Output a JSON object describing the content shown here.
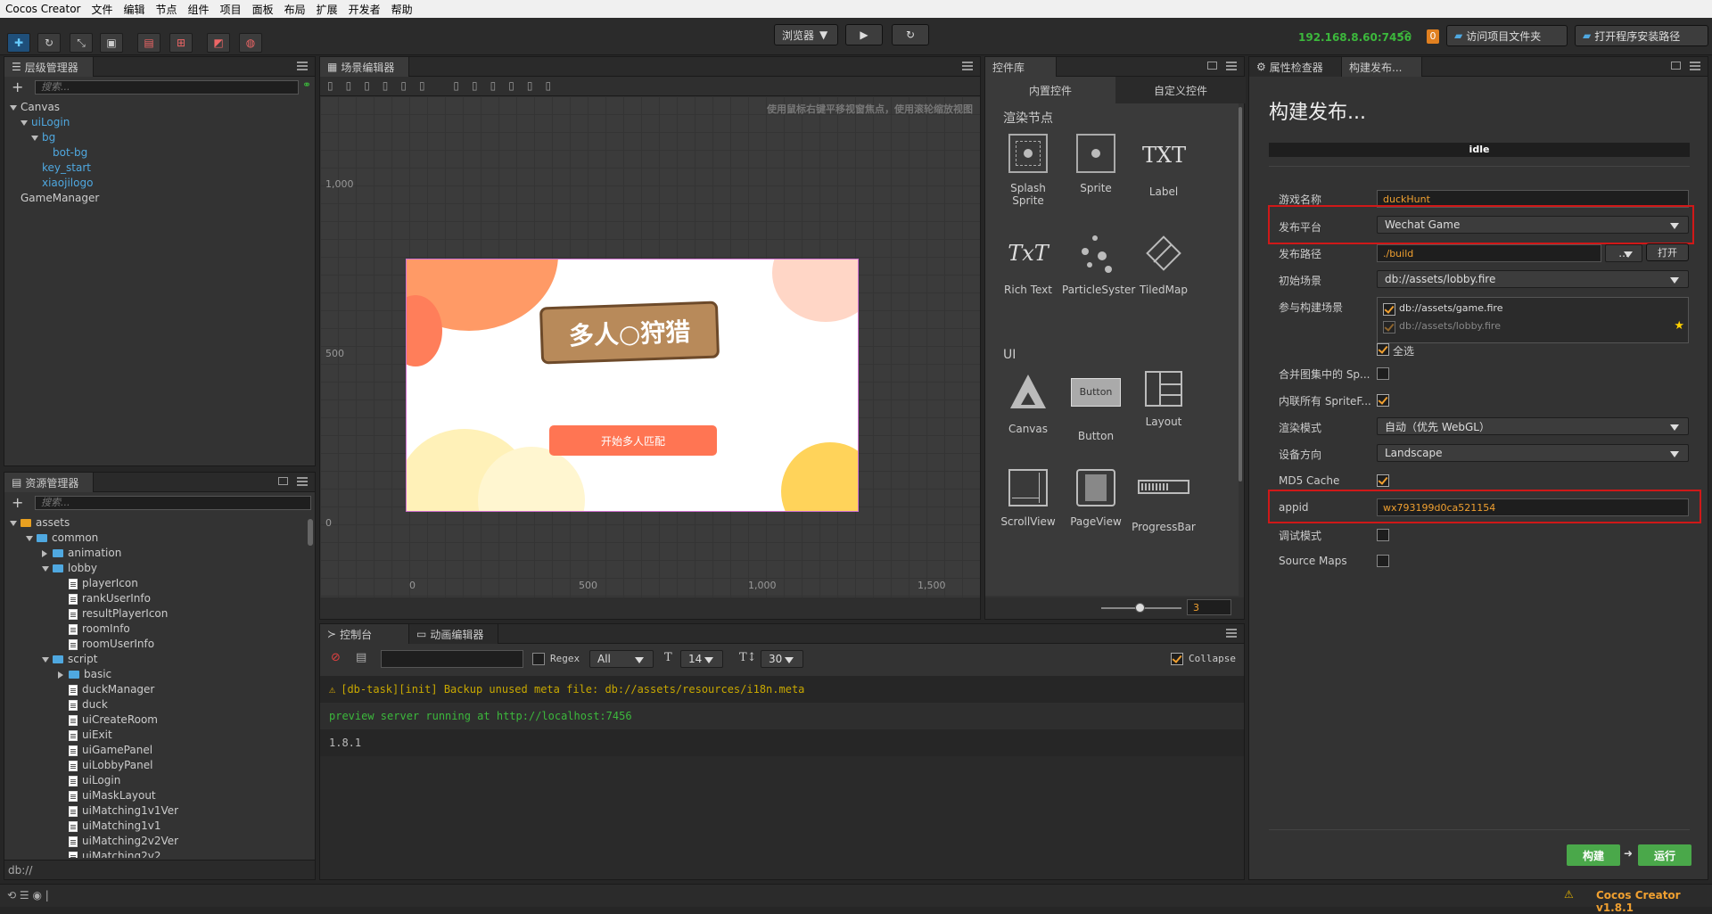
{
  "menubar": {
    "app": "Cocos Creator",
    "items": [
      "文件",
      "编辑",
      "节点",
      "组件",
      "项目",
      "面板",
      "布局",
      "扩展",
      "开发者",
      "帮助"
    ]
  },
  "toolbar": {
    "browser_label": "浏览器",
    "ip": "192.168.8.60:7456",
    "badge": "0",
    "open_project_folder": "访问项目文件夹",
    "open_install_path": "打开程序安装路径"
  },
  "hierarchy": {
    "title": "层级管理器",
    "search_placeholder": "搜索...",
    "nodes": [
      {
        "label": "Canvas",
        "depth": 0,
        "expanded": true
      },
      {
        "label": "uiLogin",
        "depth": 1,
        "expanded": true
      },
      {
        "label": "bg",
        "depth": 2,
        "expanded": true
      },
      {
        "label": "bot-bg",
        "depth": 3
      },
      {
        "label": "key_start",
        "depth": 2
      },
      {
        "label": "xiaojilogo",
        "depth": 2
      },
      {
        "label": "GameManager",
        "depth": 0
      }
    ]
  },
  "assets": {
    "title": "资源管理器",
    "search_placeholder": "搜索...",
    "footer_path": "db://",
    "items": [
      {
        "label": "assets",
        "depth": 0,
        "type": "root"
      },
      {
        "label": "common",
        "depth": 1,
        "type": "folder",
        "expanded": true
      },
      {
        "label": "animation",
        "depth": 2,
        "type": "folder",
        "expanded": false
      },
      {
        "label": "lobby",
        "depth": 2,
        "type": "folder",
        "expanded": true
      },
      {
        "label": "playerIcon",
        "depth": 3,
        "type": "file"
      },
      {
        "label": "rankUserInfo",
        "depth": 3,
        "type": "file"
      },
      {
        "label": "resultPlayerIcon",
        "depth": 3,
        "type": "file"
      },
      {
        "label": "roomInfo",
        "depth": 3,
        "type": "file"
      },
      {
        "label": "roomUserInfo",
        "depth": 3,
        "type": "file"
      },
      {
        "label": "script",
        "depth": 2,
        "type": "folder",
        "expanded": true
      },
      {
        "label": "basic",
        "depth": 3,
        "type": "folder",
        "expanded": false
      },
      {
        "label": "duckManager",
        "depth": 3,
        "type": "file"
      },
      {
        "label": "duck",
        "depth": 3,
        "type": "file"
      },
      {
        "label": "uiCreateRoom",
        "depth": 3,
        "type": "file"
      },
      {
        "label": "uiExit",
        "depth": 3,
        "type": "file"
      },
      {
        "label": "uiGamePanel",
        "depth": 3,
        "type": "file"
      },
      {
        "label": "uiLobbyPanel",
        "depth": 3,
        "type": "file"
      },
      {
        "label": "uiLogin",
        "depth": 3,
        "type": "file"
      },
      {
        "label": "uiMaskLayout",
        "depth": 3,
        "type": "file"
      },
      {
        "label": "uiMatching1v1Ver",
        "depth": 3,
        "type": "file"
      },
      {
        "label": "uiMatching1v1",
        "depth": 3,
        "type": "file"
      },
      {
        "label": "uiMatching2v2Ver",
        "depth": 3,
        "type": "file"
      },
      {
        "label": "uiMatching2v2",
        "depth": 3,
        "type": "file"
      }
    ]
  },
  "scene": {
    "title": "场景编辑器",
    "hint": "使用鼠标右键平移视窗焦点，使用滚轮缩放视图",
    "y_ticks": [
      "1,000",
      "500",
      "0"
    ],
    "x_ticks": [
      "0",
      "500",
      "1,000",
      "1,500"
    ],
    "game_logo": "多人○狩猎",
    "start_button": "开始多人匹配"
  },
  "widgets": {
    "title": "控件库",
    "tab_builtin": "内置控件",
    "tab_custom": "自定义控件",
    "section_render": "渲染节点",
    "section_ui": "UI",
    "render_items": [
      "Splash Sprite",
      "Sprite",
      "Label",
      "Rich Text",
      "ParticleSyster",
      "TiledMap"
    ],
    "ui_items": [
      "Canvas",
      "Button",
      "Layout",
      "ScrollView",
      "PageView",
      "ProgressBar"
    ],
    "label_glyph": "TXT",
    "richtext_glyph": "TxT",
    "button_glyph": "Button",
    "zoom_value": "3"
  },
  "console": {
    "tab_console": "控制台",
    "tab_anim": "动画编辑器",
    "regex_label": "Regex",
    "filter_value": "All",
    "font_size": "14",
    "line_height": "30",
    "collapse_label": "Collapse",
    "logs": [
      {
        "level": "warn",
        "text": "[db-task][init] Backup unused meta file: db://assets/resources/i18n.meta"
      },
      {
        "level": "info",
        "text": "preview server running at http://localhost:7456"
      },
      {
        "level": "log",
        "text": "1.8.1"
      }
    ]
  },
  "inspector": {
    "tab_props": "属性检查器",
    "tab_build": "构建发布...",
    "heading": "构建发布...",
    "status": "idle",
    "game_name_label": "游戏名称",
    "game_name": "duckHunt",
    "platform_label": "发布平台",
    "platform": "Wechat Game",
    "path_label": "发布路径",
    "path": "./build",
    "path_browse": "...",
    "path_open": "打开",
    "start_scene_label": "初始场景",
    "start_scene": "db://assets/lobby.fire",
    "scenes_label": "参与构建场景",
    "scene_1": "db://assets/game.fire",
    "scene_2": "db://assets/lobby.fire",
    "select_all": "全选",
    "merge_label": "合并图集中的 Sp...",
    "inline_label": "内联所有 SpriteF...",
    "render_mode_label": "渲染模式",
    "render_mode": "自动（优先 WebGL）",
    "orientation_label": "设备方向",
    "orientation": "Landscape",
    "md5_label": "MD5 Cache",
    "appid_label": "appid",
    "appid": "wx793199d0ca521154",
    "debug_label": "调试模式",
    "sourcemaps_label": "Source Maps",
    "build_button": "构建",
    "run_button": "运行"
  },
  "statusbar": {
    "version": "Cocos Creator v1.8.1"
  },
  "colors": {
    "accent_blue": "#4fa8e0",
    "highlight_red": "#d01818",
    "build_green": "#4aa84a",
    "warn_orange": "#f0a030"
  }
}
